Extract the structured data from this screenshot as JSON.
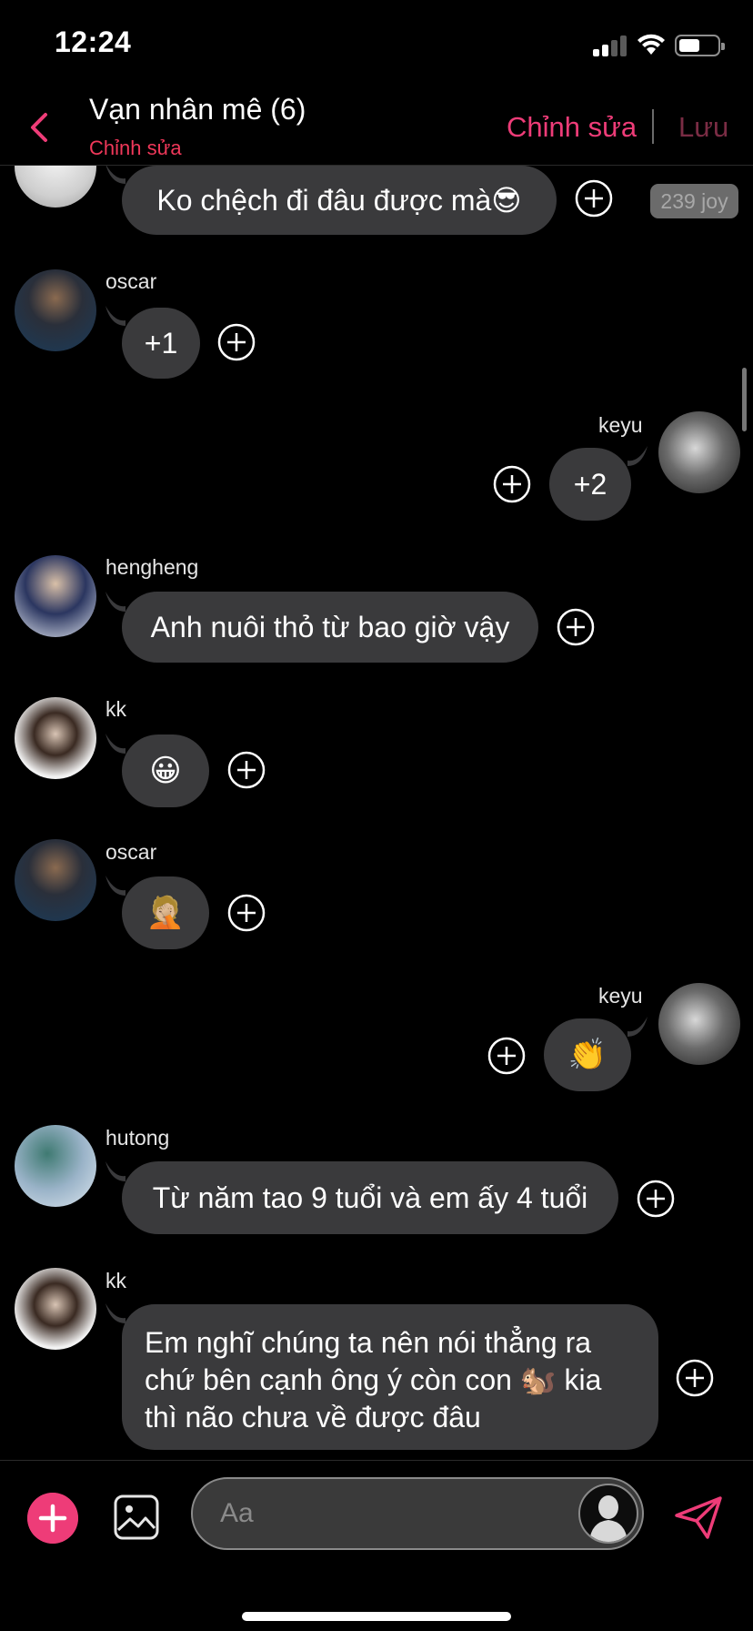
{
  "status_bar": {
    "time": "12:24"
  },
  "header": {
    "title": "Vạn nhân mê (6)",
    "subtitle": "Chỉnh sửa",
    "edit_label": "Chỉnh sửa",
    "save_label": "Lưu"
  },
  "badge": {
    "joy": "239 joy"
  },
  "messages": [
    {
      "sender": "",
      "text": "Ko chệch đi đâu được mà😎",
      "side": "left"
    },
    {
      "sender": "oscar",
      "text": "+1",
      "side": "left"
    },
    {
      "sender": "keyu",
      "text": "+2",
      "side": "right"
    },
    {
      "sender": "hengheng",
      "text": "Anh nuôi thỏ từ bao giờ vậy",
      "side": "left"
    },
    {
      "sender": "kk",
      "text": "😀",
      "side": "left"
    },
    {
      "sender": "oscar",
      "text": "🤦🏼",
      "side": "left"
    },
    {
      "sender": "keyu",
      "text": "👏",
      "side": "right"
    },
    {
      "sender": "hutong",
      "text": "Từ năm tao 9 tuổi và em ấy 4 tuổi",
      "side": "left"
    },
    {
      "sender": "kk",
      "text": "Em nghĩ chúng ta nên nói thẳng ra chứ bên cạnh ông ý còn con 🐿️ kia thì não chưa về được đâu",
      "side": "left"
    }
  ],
  "composer": {
    "placeholder": "Aa"
  },
  "colors": {
    "accent": "#ee3c78",
    "bubble": "#3a3a3c",
    "background": "#000000",
    "save_disabled": "#7a2c44"
  },
  "icons": [
    "back-chevron-icon",
    "plus-icon",
    "image-gallery-icon",
    "send-icon",
    "add-reaction-icon",
    "wifi-icon",
    "battery-icon",
    "signal-icon"
  ]
}
